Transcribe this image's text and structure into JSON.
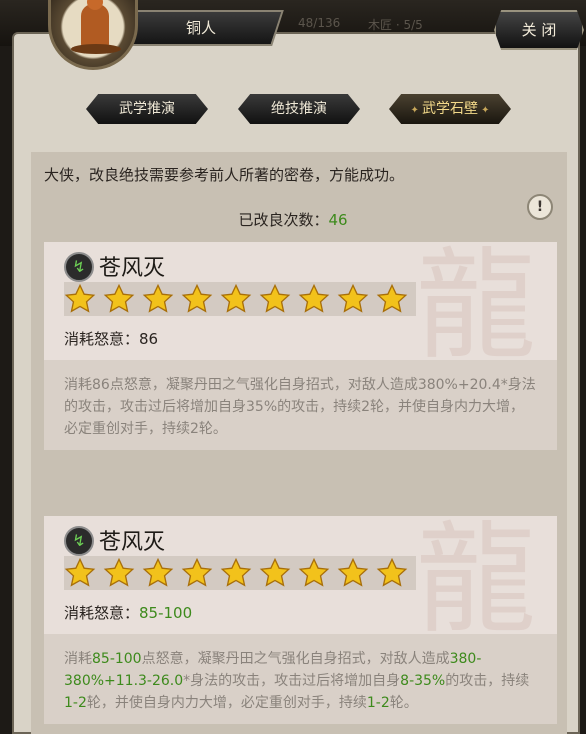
{
  "header": {
    "title": "铜人",
    "close_label": "关 闭",
    "ghost_left": "48/136",
    "ghost_right": "木匠 · 5/5"
  },
  "tabs": [
    {
      "label": "武学推演",
      "active": false
    },
    {
      "label": "绝技推演",
      "active": false
    },
    {
      "label": "武学石壁",
      "active": true
    }
  ],
  "notice": "大侠，改良绝技需要参考前人所著的密卷，方能成功。",
  "improve_count": {
    "label": "已改良次数：",
    "value": "46"
  },
  "cards": [
    {
      "name": "苍风灭",
      "stars": 9,
      "cost_label": "消耗怒意：",
      "cost_value": "86",
      "desc": "消耗86点怒意，凝聚丹田之气强化自身招式，对敌人造成380%+20.4*身法的攻击，攻击过后将增加自身35%的攻击，持续2轮，并使自身内力大增，必定重创对手，持续2轮。"
    },
    {
      "name": "苍风灭",
      "stars": 9,
      "cost_label": "消耗怒意：",
      "cost_value": "85-100",
      "desc_parts": [
        {
          "t": "消耗",
          "g": false
        },
        {
          "t": "85-100",
          "g": true
        },
        {
          "t": "点怒意，凝聚丹田之气强化自身招式，对敌人造成",
          "g": false
        },
        {
          "t": "380-380%+11.3-26.0",
          "g": true
        },
        {
          "t": "*身法的攻击，攻击过后将增加自身",
          "g": false
        },
        {
          "t": "8-35%",
          "g": true
        },
        {
          "t": "的攻击，持续",
          "g": false
        },
        {
          "t": "1-2",
          "g": true
        },
        {
          "t": "轮，并使自身内力大增，必定重创对手，持续",
          "g": false
        },
        {
          "t": "1-2",
          "g": true
        },
        {
          "t": "轮。",
          "g": false
        }
      ]
    }
  ],
  "colors": {
    "green": "#3d8a1c",
    "star": "#f2c21b"
  },
  "icons": {
    "skill": "wind-swirl-icon",
    "info": "exclamation-icon",
    "dragon": "dragon-watermark-icon"
  }
}
